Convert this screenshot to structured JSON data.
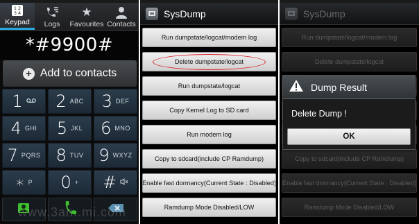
{
  "dialer": {
    "tabs": [
      {
        "label": "Keypad",
        "icon": "keypad-icon",
        "active": true
      },
      {
        "label": "Logs",
        "icon": "call-log-icon",
        "active": false
      },
      {
        "label": "Favourites",
        "icon": "star-icon",
        "active": false
      },
      {
        "label": "Contacts",
        "icon": "person-icon",
        "active": false
      }
    ],
    "number": "*#9900#",
    "add_to_contacts": "Add to contacts",
    "keys": [
      {
        "digit": "1",
        "letters": "oo",
        "icon": "voicemail-icon"
      },
      {
        "digit": "2",
        "letters": "ABC"
      },
      {
        "digit": "3",
        "letters": "DEF"
      },
      {
        "digit": "4",
        "letters": "GHI"
      },
      {
        "digit": "5",
        "letters": "JKL"
      },
      {
        "digit": "6",
        "letters": "MNO"
      },
      {
        "digit": "7",
        "letters": "PQRS"
      },
      {
        "digit": "8",
        "letters": "TUV"
      },
      {
        "digit": "9",
        "letters": "WXYZ"
      },
      {
        "digit": "∗",
        "letters": "P"
      },
      {
        "digit": "0",
        "letters": "+"
      },
      {
        "digit": "#",
        "letters": "⇆",
        "icon": "mute-icon"
      }
    ],
    "actions": [
      "video-call-icon",
      "phone-icon",
      "backspace-icon"
    ],
    "watermark": "www.3an..mi.com"
  },
  "sysdump": {
    "title": "SysDump",
    "buttons": [
      "Run dumpstate/logcat/modem log",
      "Delete dumpstate/logcat",
      "Run dumpstate/logcat",
      "Copy Kernel Log to SD card",
      "Run modem log",
      "Copy to sdcard(include CP Ramdump)",
      "Enable fast dormancy(Current State : Disabled)",
      "Ramdump Mode Disabled/LOW"
    ],
    "highlighted_index": 1,
    "highlight_color": "#d9262c"
  },
  "dialog_screen": {
    "title": "SysDump",
    "dialog": {
      "title": "Dump Result",
      "message": "Delete Dump !",
      "ok_label": "OK",
      "icon": "warning-icon"
    }
  },
  "colors": {
    "tab_accent": "#2aa6e0",
    "key_bg": "#1d2a36",
    "call_green": "#3fbf2f"
  }
}
